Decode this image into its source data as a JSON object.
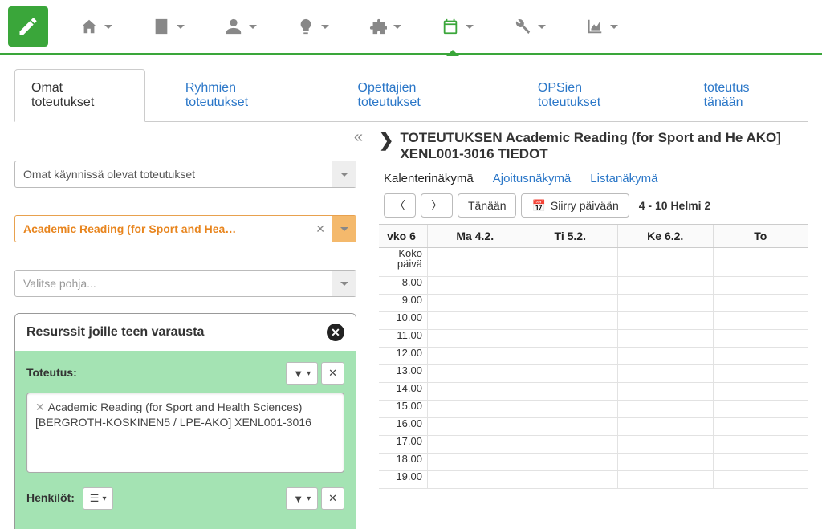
{
  "tabs": [
    "Omat toteutukset",
    "Ryhmien toteutukset",
    "Opettajien toteutukset",
    "OPSien toteutukset",
    "toteutus tänään"
  ],
  "activeTab": 0,
  "selects": {
    "running": {
      "text": "Omat käynnissä olevat toteutukset"
    },
    "course": {
      "text": "Academic Reading (for Sport and Hea…"
    },
    "template": {
      "text": "Valitse pohja..."
    }
  },
  "resources": {
    "title": "Resurssit joille teen varausta",
    "toteutus_label": "Toteutus:",
    "toteutus_item": "Academic Reading (for Sport and Health Sciences) [BERGROTH-KOSKINEN5 / LPE-AKO] XENL001-3016",
    "henkilot_label": "Henkilöt:"
  },
  "detail_title": "TOTEUTUKSEN Academic Reading (for Sport and He AKO] XENL001-3016 TIEDOT",
  "view_tabs": [
    "Kalenterinäkymä",
    "Ajoitusnäkymä",
    "Listanäkymä"
  ],
  "cal": {
    "today_btn": "Tänään",
    "goto_btn": "Siirry päivään",
    "range": "4 - 10 Helmi 2",
    "week": "vko 6",
    "allday": "Koko\npäivä",
    "days": [
      "Ma 4.2.",
      "Ti 5.2.",
      "Ke 6.2.",
      "To "
    ],
    "hours": [
      "8.00",
      "9.00",
      "10.00",
      "11.00",
      "12.00",
      "13.00",
      "14.00",
      "15.00",
      "16.00",
      "17.00",
      "18.00",
      "19.00"
    ]
  }
}
